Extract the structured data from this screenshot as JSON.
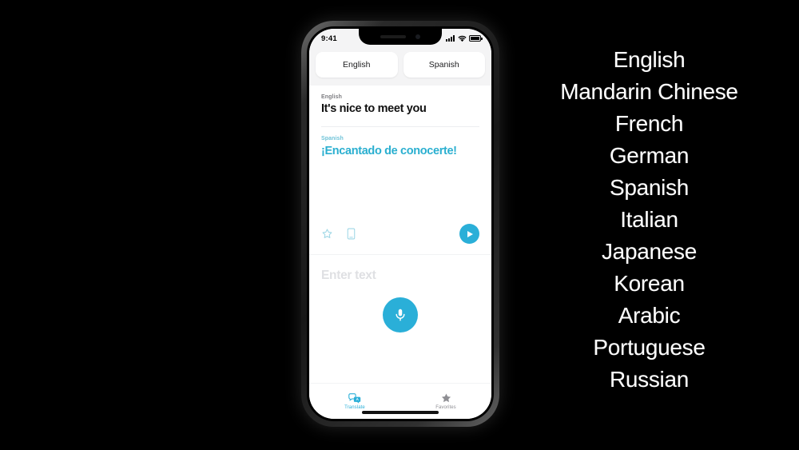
{
  "phone": {
    "status_bar": {
      "time": "9:41",
      "icons": [
        "signal-bars-icon",
        "wifi-icon",
        "battery-icon"
      ]
    },
    "language_selector": {
      "source_button": "English",
      "target_button": "Spanish"
    },
    "translation_card": {
      "source_language_label": "English",
      "source_text": "It's nice to meet you",
      "target_language_label": "Spanish",
      "target_text": "¡Encantado de conocerte!",
      "actions": {
        "favorite_icon": "star-icon",
        "fullscreen_device_icon": "device-icon",
        "play_icon": "play-icon"
      }
    },
    "input_area": {
      "placeholder": "Enter text",
      "mic_icon": "microphone-icon"
    },
    "tab_bar": [
      {
        "label": "Translate",
        "icon": "translate-bubbles-icon",
        "active": true
      },
      {
        "label": "Favorites",
        "icon": "star-icon",
        "active": false
      }
    ]
  },
  "language_list": {
    "items": [
      "English",
      "Mandarin Chinese",
      "French",
      "German",
      "Spanish",
      "Italian",
      "Japanese",
      "Korean",
      "Arabic",
      "Portuguese",
      "Russian"
    ]
  },
  "colors": {
    "background": "#000000",
    "accent": "#2aafd8",
    "target_text": "#2aafd0",
    "screen": "#ffffff",
    "chrome": "#f4f4f5",
    "list_text": "#ffffff"
  }
}
